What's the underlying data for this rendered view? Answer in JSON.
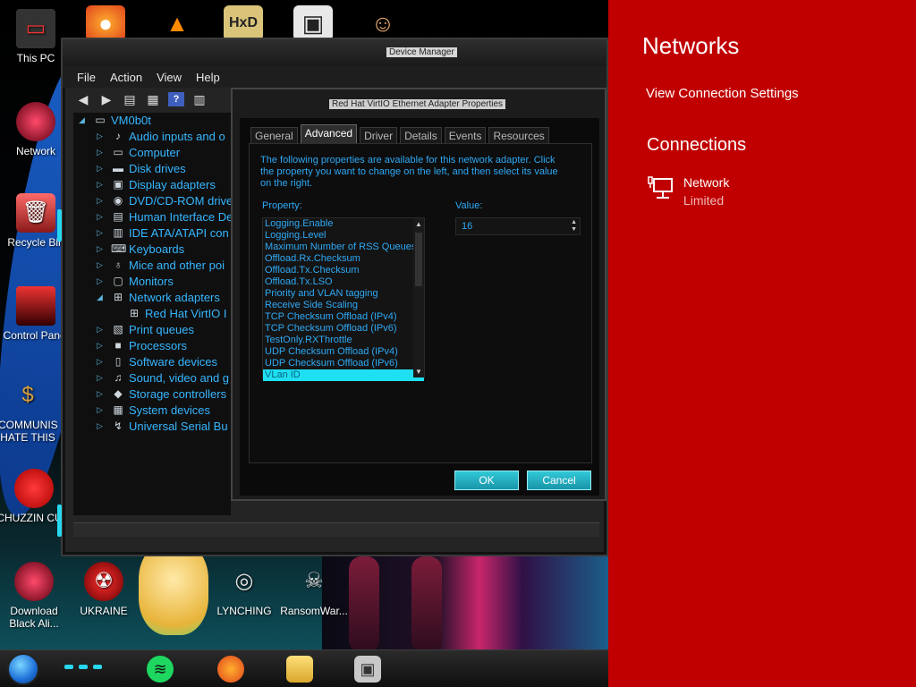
{
  "desktop": {
    "icons": [
      {
        "label": "This PC"
      },
      {
        "label": "Network"
      },
      {
        "label": "Recycle Bin"
      },
      {
        "label": "Control Panel"
      },
      {
        "label": "COMMUNISM HATE THIS"
      },
      {
        "label": "CHUZZIN CUM"
      },
      {
        "label": "Download Black Ali..."
      },
      {
        "label": "UKRAINE"
      },
      {
        "label": "LYNCHING"
      },
      {
        "label": "RansomWar..."
      }
    ]
  },
  "device_manager": {
    "title": "Device Manager",
    "menu": [
      "File",
      "Action",
      "View",
      "Help"
    ],
    "tree": {
      "root": "VM0b0t",
      "items": [
        {
          "label": "Audio inputs and o",
          "icon": "speaker-icon"
        },
        {
          "label": "Computer",
          "icon": "computer-icon"
        },
        {
          "label": "Disk drives",
          "icon": "disk-icon"
        },
        {
          "label": "Display adapters",
          "icon": "display-icon"
        },
        {
          "label": "DVD/CD-ROM drive",
          "icon": "dvd-icon"
        },
        {
          "label": "Human Interface De",
          "icon": "hid-icon"
        },
        {
          "label": "IDE ATA/ATAPI con",
          "icon": "ide-icon"
        },
        {
          "label": "Keyboards",
          "icon": "keyboard-icon"
        },
        {
          "label": "Mice and other poi",
          "icon": "mouse-icon"
        },
        {
          "label": "Monitors",
          "icon": "monitor-icon"
        },
        {
          "label": "Network adapters",
          "icon": "network-icon"
        },
        {
          "label": "Red Hat VirtIO I",
          "icon": "network-card-icon"
        },
        {
          "label": "Print queues",
          "icon": "printer-icon"
        },
        {
          "label": "Processors",
          "icon": "processor-icon"
        },
        {
          "label": "Software devices",
          "icon": "software-icon"
        },
        {
          "label": "Sound, video and g",
          "icon": "sound-icon"
        },
        {
          "label": "Storage controllers",
          "icon": "storage-icon"
        },
        {
          "label": "System devices",
          "icon": "system-icon"
        },
        {
          "label": "Universal Serial Bu",
          "icon": "usb-icon"
        }
      ]
    }
  },
  "properties_dialog": {
    "title": "Red Hat VirtIO Ethernet Adapter Properties",
    "tabs": [
      "General",
      "Advanced",
      "Driver",
      "Details",
      "Events",
      "Resources"
    ],
    "active_tab": "Advanced",
    "description": "The following properties are available for this network adapter. Click the property you want to change on the left, and then select its value on the right.",
    "property_label": "Property:",
    "value_label": "Value:",
    "properties": [
      "Logging.Enable",
      "Logging.Level",
      "Maximum Number of RSS Queues",
      "Offload.Rx.Checksum",
      "Offload.Tx.Checksum",
      "Offload.Tx.LSO",
      "Priority and VLAN tagging",
      "Receive Side Scaling",
      "TCP Checksum Offload (IPv4)",
      "TCP Checksum Offload (IPv6)",
      "TestOnly.RXThrottle",
      "UDP Checksum Offload (IPv4)",
      "UDP Checksum Offload (IPv6)",
      "VLan ID"
    ],
    "selected_property": "VLan ID",
    "value": "16",
    "ok_label": "OK",
    "cancel_label": "Cancel"
  },
  "network_flyout": {
    "title": "Networks",
    "view_settings": "View Connection Settings",
    "connections_heading": "Connections",
    "network_name": "Network",
    "network_status": "Limited",
    "background": "#c00000"
  },
  "taskbar": {
    "pinned": [
      "spotify-icon",
      "firefox-icon",
      "file-explorer-icon",
      "device-manager-icon"
    ]
  }
}
